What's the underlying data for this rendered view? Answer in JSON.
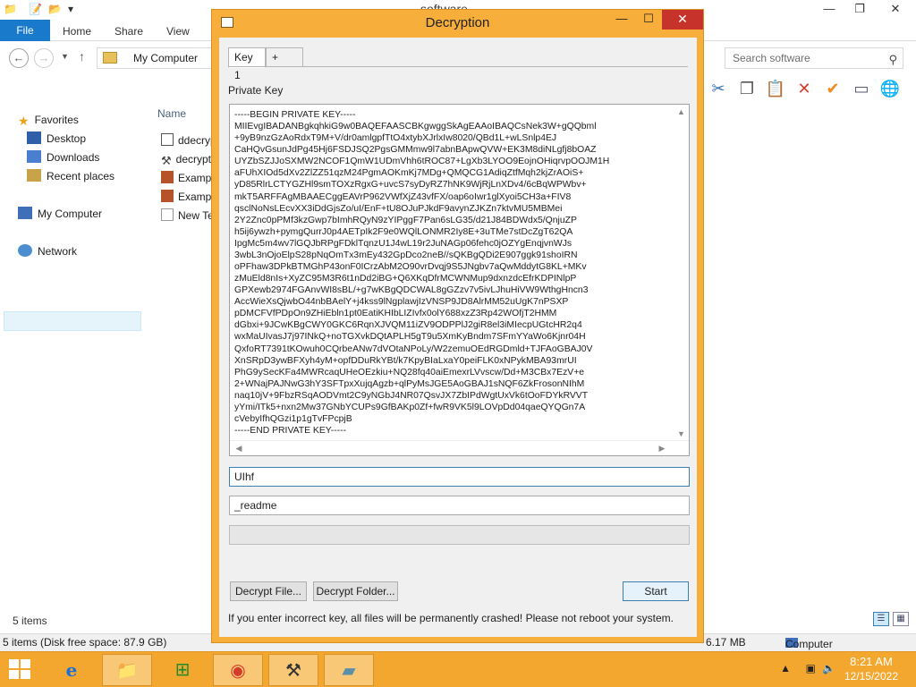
{
  "explorer": {
    "title": "software",
    "ribbon_tabs": [
      "File",
      "Home",
      "Share",
      "View"
    ],
    "address": "My Computer",
    "search_placeholder": "Search software",
    "nav": {
      "favorites": "Favorites",
      "desktop": "Desktop",
      "downloads": "Downloads",
      "recent_places": "Recent places",
      "my_computer": "My Computer",
      "network": "Network"
    },
    "column_header": "Name",
    "files": [
      "ddecryp",
      "decrypt",
      "Exampl",
      "Exampl",
      "New Te"
    ],
    "items_count": "5 items",
    "status_left": "5 items (Disk free space: 87.9 GB)",
    "status_size": "6.17 MB",
    "status_location": "Computer"
  },
  "dialog": {
    "title": "Decryption",
    "tabs": [
      "Key 1",
      "+"
    ],
    "private_key_label": "Private Key",
    "private_key_text": "-----BEGIN PRIVATE KEY-----\nMIIEvgIBADANBgkqhkiG9w0BAQEFAASCBKgwggSkAgEAAoIBAQCsNek3W+gQQbml\n+9yB9nzGzAoRdxT9M+V/dr0amlgpfTtO4xtybXJrlxIw8020/QBd1L+wLSnlp4EJ\nCaHQvGsunJdPg45Hj6FSDJSQ2PgsGMMmw9l7abnBApwQVW+EK3M8diNLgfj8bOAZ\nUYZbSZJJoSXMW2NCOF1QmW1UDmVhh6tROC87+LgXb3LYOO9EojnOHiqrvpOOJM1H\naFUhXIOd5dXv2ZlZZ51qzM24PgmAOKmKj7MDg+QMQCG1AdiqZtfMqh2kjZrAOiS+\nyD85RlrLCTYGZHl9smTOXzRgxG+uvcS7syDyRZ7hNK9WjRjLnXDv4/6cBqWPWbv+\nmkT5ARFFAgMBAAECggEAVrP962VWfXjZ43vfFX/oap6oIwr1glXyoi5CH3a+FIV8\nqsclNoNsLEcvXX3iDdGjsZo/uI/EnF+tU8OJuPJkdF9avynZJKZn7ktvMU5MBMei\n2Y2Znc0pPMf3kzGwp7bImhRQyN9zYIPggF7Pan6sLG35/d21J84BDWdx5/QnjuZP\nh5ij6ywzh+pymgQurrJ0p4AETpIk2F9e0WQlLONMR2Iy8E+3uTMe7stDcZgT62QA\nIpgMc5m4wv7lGQJbRPgFDklTqnzU1J4wL19r2JuNAGp06fehc0jOZYgEnqjvnWJs\n3wbL3nOjoElpS28pNqOmTx3mEy432GpDco2neB//sQKBgQDi2E907ggk91shoIRN\noPFhaw3DPkBTMGhP43onF0ICrzAbM2O90vrDvqj9S5JNgbv7aQwMddytG8KL+MKv\nzMuEld8nIs+XyZC95M3R6t1nDd2iBG+Q6XKqDfrMCWNMup9dxnzdcEfrKDPINlpP\nGPXewb2974FGAnvWI8sBL/+g7wKBgQDCWAL8gGZzv7v5ivLJhuHiVW9WthgHncn3\nAccWieXsQjwbO44nbBAelY+j4kss9lNgplawjIzVNSP9JD8AlrMM52uUgK7nPSXP\npDMCFVfPDpOn9ZHiEbln1pt0EatiKHIbLIZIvfx0olY688xzZ3Rp42WOfjT2HMM\ndGbxi+9JCwKBgCWY0GKC6RqnXJVQM11iZV9ODPPlJ2giR8el3iMIecpUGtcHR2q4\nwxMaUIvasJ7j97INkQ+noTGXvkDQtAPLH5gT9u5XmKyBndm7SFmYYaWo6Kjnr04H\nQxfoRT7391tKOwuh0CQrbeANw7dVOtaNPoLy/W2zemuOEdRGDmld+TJFAoGBAJ0V\nXnSRpD3ywBFXyh4yM+opfDDuRkYBt/k7KpyBIaLxaY0peiFLK0xNPykMBA93mrUI\nPhG9ySecKFa4MWRcaqUHeOEzkiu+NQ28fq40aiEmexrLVvscw/Dd+M3CBx7EzV+e\n2+WNajPAJNwG3hY3SFTpxXujqAgzb+qlPyMsJGE5AoGBAJ1sNQF6ZkFrosonNIhM\nnaq10jV+9FbzRSqAODVmt2C9yNGbJ4NR07QsvJX7ZbIPdWgtUxVk6tOoFDYkRVVT\nyYmi/ITk5+nxn2Mw37GNbYCUPs9GfBAKp0Zf+fwR9VK5l9LOVpDd04qaeQYQGn7A\ncVebyIfhQGzi1p1gTvFPcpjB\n-----END PRIVATE KEY-----",
    "field1_value": "UIhf",
    "field2_value": "_readme",
    "progress_percent": 0,
    "buttons": {
      "decrypt_file": "Decrypt File...",
      "decrypt_folder": "Decrypt Folder...",
      "start": "Start",
      "minimize": "—",
      "maximize": "☐",
      "close": "✕"
    },
    "warning": "If you enter incorrect key, all files will be permanently crashed! Please not reboot your system."
  },
  "taskbar": {
    "apps": [
      "internet-explorer",
      "file-explorer",
      "store",
      "chrome",
      "tool",
      "notepad"
    ],
    "time": "8:21 AM",
    "date": "12/15/2022"
  },
  "colors": {
    "dialog_frame": "#f7ae3a",
    "taskbar": "#f4a72f",
    "close_button": "#c7332b",
    "ribbon_file_tab": "#1979ca"
  }
}
